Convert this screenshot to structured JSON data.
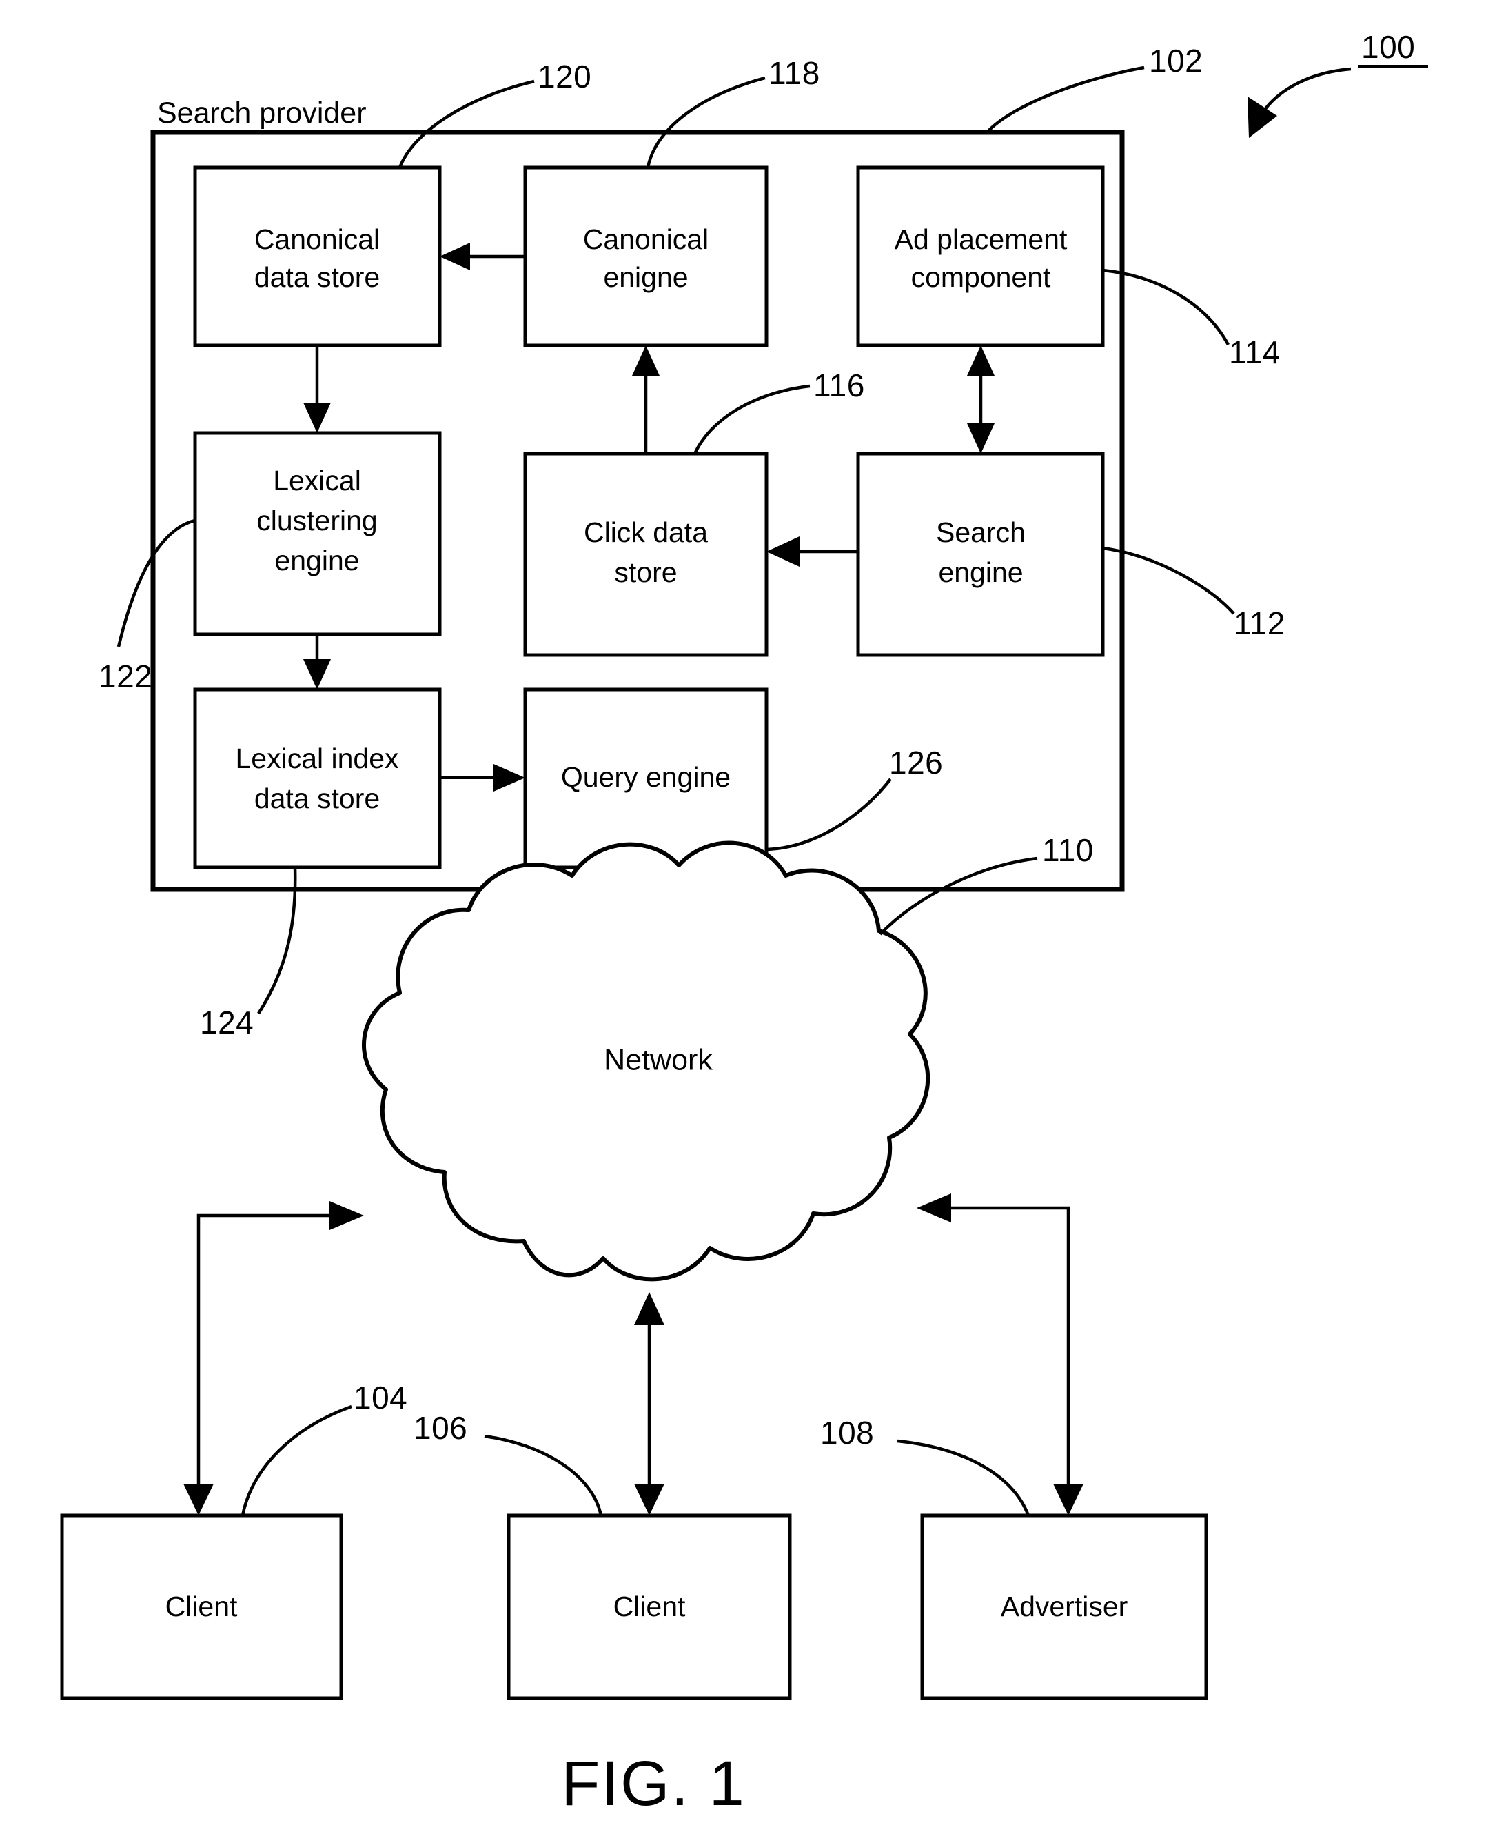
{
  "figure": {
    "caption": "FIG. 1",
    "figure_ref": "100"
  },
  "container": {
    "title": "Search provider",
    "ref": "102"
  },
  "nodes": [
    {
      "id": "canonical-data-store",
      "line1": "Canonical",
      "line2": "data store",
      "ref": "120"
    },
    {
      "id": "canonical-engine",
      "line1": "Canonical",
      "line2": "enigne",
      "ref": "118"
    },
    {
      "id": "ad-placement-component",
      "line1": "Ad placement",
      "line2": "component",
      "ref": "114"
    },
    {
      "id": "lexical-clustering-engine",
      "line1": "Lexical",
      "line2": "clustering",
      "line3": "engine",
      "ref": "122"
    },
    {
      "id": "click-data-store",
      "line1": "Click data",
      "line2": "store",
      "ref": "116"
    },
    {
      "id": "search-engine",
      "line1": "Search",
      "line2": "engine",
      "ref": "112"
    },
    {
      "id": "lexical-index-data-store",
      "line1": "Lexical index",
      "line2": "data store",
      "ref": "124"
    },
    {
      "id": "query-engine",
      "line1": "Query engine",
      "line2": "",
      "ref": "126"
    },
    {
      "id": "network",
      "line1": "Network",
      "line2": "",
      "ref": "110"
    },
    {
      "id": "client-left",
      "line1": "Client",
      "line2": "",
      "ref": "104"
    },
    {
      "id": "client-middle",
      "line1": "Client",
      "line2": "",
      "ref": "106"
    },
    {
      "id": "advertiser",
      "line1": "Advertiser",
      "line2": "",
      "ref": "108"
    }
  ],
  "refs": {
    "r100": "100",
    "r102": "102",
    "r104": "104",
    "r106": "106",
    "r108": "108",
    "r110": "110",
    "r112": "112",
    "r114": "114",
    "r116": "116",
    "r118": "118",
    "r120": "120",
    "r122": "122",
    "r124": "124",
    "r126": "126"
  },
  "colors": {
    "ink": "#000000",
    "paper": "#ffffff"
  }
}
